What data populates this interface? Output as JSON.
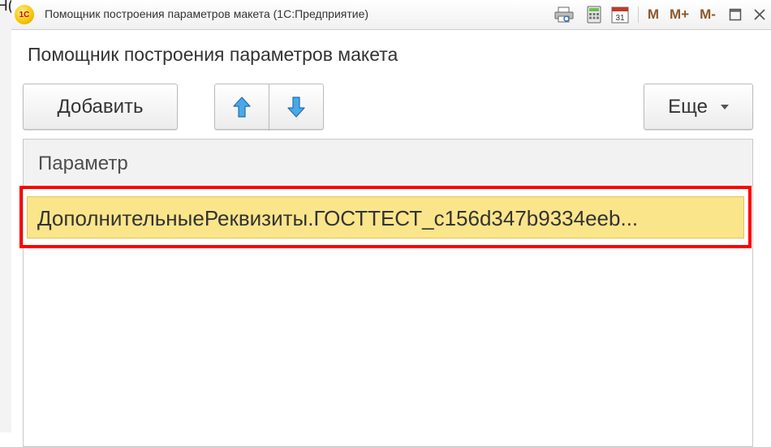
{
  "background": {
    "partial_text": "Н("
  },
  "window": {
    "title": "Помощник построения параметров макета  (1С:Предприятие)",
    "app_icon_label": "1С",
    "icons": [
      "print-preview-icon",
      "calculator-icon",
      "calendar-icon",
      "maximize-icon",
      "close-icon"
    ],
    "calendar_day": "31",
    "memory_buttons": {
      "m": "M",
      "m_plus": "M+",
      "m_minus": "M-"
    }
  },
  "form": {
    "title": "Помощник построения параметров макета",
    "toolbar": {
      "add_label": "Добавить",
      "move_up_icon": "arrow-up-icon",
      "move_down_icon": "arrow-down-icon",
      "more_label": "Еще"
    },
    "table": {
      "columns": [
        "Параметр"
      ],
      "rows": [
        {
          "parameter": "ДополнительныеРеквизиты.ГОСТТЕСТ_c156d347b9334eeb..."
        }
      ]
    }
  },
  "colors": {
    "selected_row": "#fbe58a",
    "highlight_border": "#ff0000",
    "arrow_blue": "#3a9ad9",
    "memory_buttons": "#8b5a2b"
  }
}
